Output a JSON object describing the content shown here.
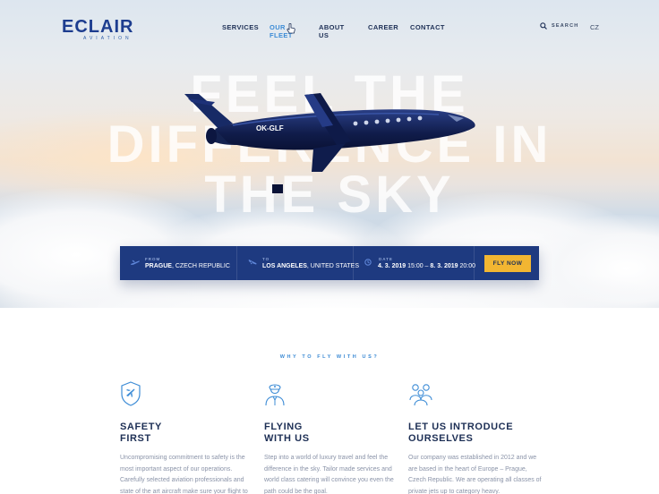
{
  "brand": {
    "name": "ECLAIR",
    "tagline": "AVIATION"
  },
  "nav": {
    "items": [
      "SERVICES",
      "OUR FLEET",
      "ABOUT US",
      "CAREER",
      "CONTACT"
    ],
    "active": "OUR FLEET"
  },
  "search": {
    "label": "SEARCH"
  },
  "language": "CZ",
  "hero": {
    "headline_lines": [
      "FEEL THE",
      "DIFFERENCE IN",
      "THE SKY"
    ],
    "aircraft_registration": "OK-GLF"
  },
  "booking": {
    "from": {
      "label": "FROM",
      "city": "PRAGUE",
      "country": ", CZECH REPUBLIC"
    },
    "to": {
      "label": "TO",
      "city": "LOS ANGELES",
      "country": ", UNITED STATES"
    },
    "date": {
      "label": "DATE",
      "start_date": "4. 3. 2019",
      "start_time": " 15:00",
      "dash": " – ",
      "end_date": "8. 3. 2019",
      "end_time": " 20:00"
    },
    "cta": "FLY NOW"
  },
  "why": {
    "title": "WHY TO FLY WITH US?",
    "features": [
      {
        "icon": "shield-plane-icon",
        "title_lines": [
          "SAFETY",
          "FIRST"
        ],
        "text": "Uncompromising commitment to safety is the most important aspect of our operations. Carefully selected aviation professionals and state of the art aircraft make sure your flight to"
      },
      {
        "icon": "pilot-icon",
        "title_lines": [
          "FLYING",
          "WITH US"
        ],
        "text": "Step into a world of luxury travel and feel the difference in the sky. Tailor made services and world class catering will convince you even the path could be the goal."
      },
      {
        "icon": "team-icon",
        "title_lines": [
          "LET US INTRODUCE",
          "OURSELVES"
        ],
        "text": "Our company was established in 2012 and we are based in the heart of Europe – Prague, Czech Republic. We are operating all classes of private jets up to category heavy."
      }
    ]
  },
  "colors": {
    "navy": "#1e3a80",
    "accent": "#f2b632",
    "link_active": "#3d8cd6"
  }
}
